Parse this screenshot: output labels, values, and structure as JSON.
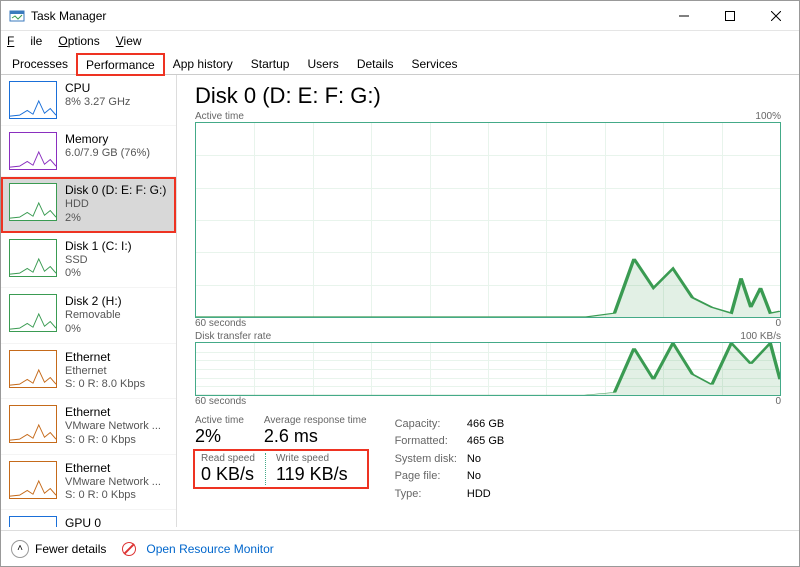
{
  "window": {
    "title": "Task Manager"
  },
  "menu": {
    "file": "File",
    "options": "Options",
    "view": "View"
  },
  "tabs": [
    "Processes",
    "Performance",
    "App history",
    "Startup",
    "Users",
    "Details",
    "Services"
  ],
  "active_tab": 1,
  "sidebar": [
    {
      "name": "CPU",
      "sub1": "8% 3.27 GHz",
      "color": "#1a6fd8"
    },
    {
      "name": "Memory",
      "sub1": "6.0/7.9 GB (76%)",
      "color": "#8a2fbf"
    },
    {
      "name": "Disk 0 (D: E: F: G:)",
      "sub1": "HDD",
      "sub2": "2%",
      "color": "#3a9b52",
      "selected": true
    },
    {
      "name": "Disk 1 (C: I:)",
      "sub1": "SSD",
      "sub2": "0%",
      "color": "#3a9b52"
    },
    {
      "name": "Disk 2 (H:)",
      "sub1": "Removable",
      "sub2": "0%",
      "color": "#3a9b52"
    },
    {
      "name": "Ethernet",
      "sub1": "Ethernet",
      "sub2": "S: 0 R: 8.0 Kbps",
      "color": "#c56a1a"
    },
    {
      "name": "Ethernet",
      "sub1": "VMware Network ...",
      "sub2": "S: 0 R: 0 Kbps",
      "color": "#c56a1a"
    },
    {
      "name": "Ethernet",
      "sub1": "VMware Network ...",
      "sub2": "S: 0 R: 0 Kbps",
      "color": "#c56a1a"
    },
    {
      "name": "GPU 0",
      "sub1": "",
      "color": "#1a6fd8"
    }
  ],
  "detail": {
    "title": "Disk 0 (D: E: F: G:)",
    "chart1": {
      "label_left": "Active time",
      "label_right": "100%",
      "axis_left": "60 seconds",
      "axis_right": "0"
    },
    "chart2": {
      "label_left": "Disk transfer rate",
      "label_right": "100 KB/s",
      "axis_left": "60 seconds",
      "axis_right": "0"
    },
    "stats": {
      "active_time": {
        "label": "Active time",
        "value": "2%"
      },
      "avg_resp": {
        "label": "Average response time",
        "value": "2.6 ms"
      },
      "read": {
        "label": "Read speed",
        "value": "0 KB/s"
      },
      "write": {
        "label": "Write speed",
        "value": "119 KB/s"
      }
    },
    "info": {
      "capacity": {
        "k": "Capacity:",
        "v": "466 GB"
      },
      "formatted": {
        "k": "Formatted:",
        "v": "465 GB"
      },
      "system": {
        "k": "System disk:",
        "v": "No"
      },
      "pagefile": {
        "k": "Page file:",
        "v": "No"
      },
      "type": {
        "k": "Type:",
        "v": "HDD"
      }
    }
  },
  "footer": {
    "fewer": "Fewer details",
    "orm": "Open Resource Monitor"
  },
  "chart_data": [
    {
      "type": "line",
      "title": "Active time",
      "xlabel": "60 seconds → 0",
      "ylabel": "%",
      "ylim": [
        0,
        100
      ],
      "x": [
        0,
        5,
        10,
        15,
        20,
        25,
        30,
        35,
        40,
        43,
        45,
        47,
        49,
        51,
        53,
        55,
        56,
        57,
        58,
        59,
        60
      ],
      "values": [
        0,
        0,
        0,
        0,
        0,
        0,
        0,
        0,
        0,
        2,
        30,
        15,
        25,
        10,
        5,
        2,
        20,
        5,
        15,
        2,
        3
      ]
    },
    {
      "type": "line",
      "title": "Disk transfer rate",
      "xlabel": "60 seconds → 0",
      "ylabel": "KB/s",
      "ylim": [
        0,
        100
      ],
      "x": [
        0,
        10,
        20,
        30,
        40,
        43,
        45,
        47,
        49,
        51,
        53,
        55,
        57,
        59,
        60
      ],
      "values": [
        0,
        0,
        0,
        0,
        0,
        5,
        90,
        30,
        100,
        40,
        20,
        100,
        60,
        100,
        30
      ]
    }
  ]
}
